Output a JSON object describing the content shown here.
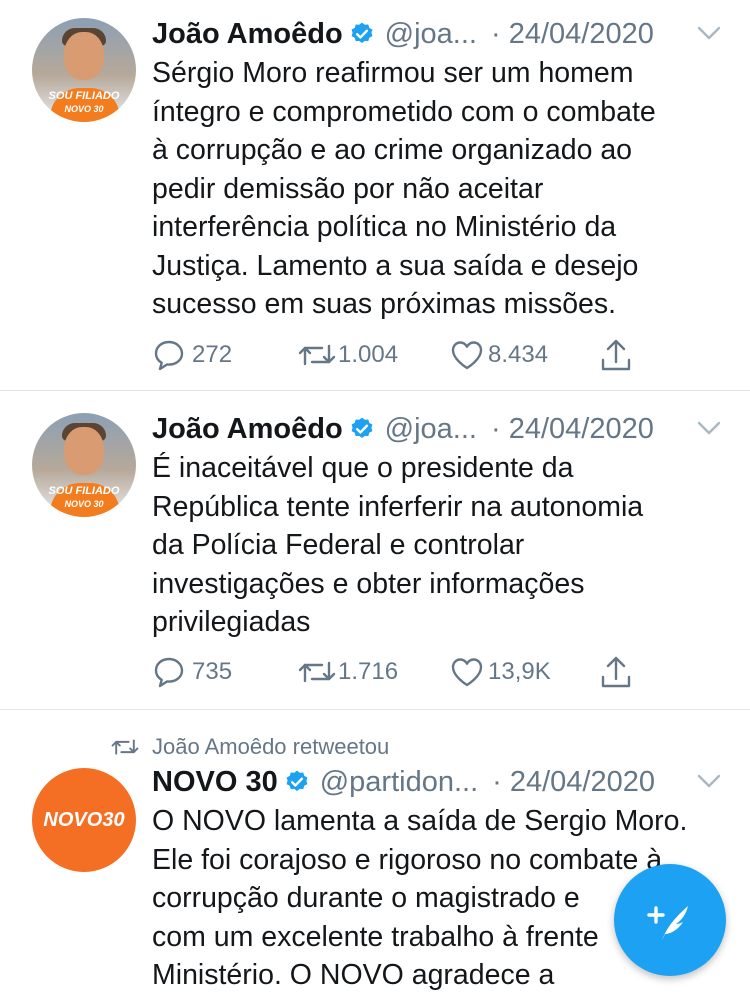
{
  "tweets": [
    {
      "author": "João Amoêdo",
      "handle": "@joa...",
      "date": "· 24/04/2020",
      "avatar": {
        "badge_top": "SOU FILIADO",
        "badge_bottom": "NOVO 30"
      },
      "text": "Sérgio Moro reafirmou ser um homem\níntegro e comprometido com o combate\nà corrupção e ao crime organizado ao\npedir demissão por não aceitar\ninterferência política no Ministério da\nJustiça. Lamento a sua saída e desejo\nsucesso em suas próximas missões.",
      "replies": "272",
      "retweets": "1.004",
      "likes": "8.434"
    },
    {
      "author": "João Amoêdo",
      "handle": "@joa...",
      "date": "· 24/04/2020",
      "avatar": {
        "badge_top": "SOU FILIADO",
        "badge_bottom": "NOVO 30"
      },
      "text": "É inaceitável que o presidente da\nRepública tente inferferir na autonomia\nda Polícia Federal e controlar\ninvestigações e obter informações\nprivilegiadas",
      "replies": "735",
      "retweets": "1.716",
      "likes": "13,9K"
    },
    {
      "retweeted_by": "João Amoêdo retweetou",
      "author": "NOVO 30",
      "handle": "@partidon...",
      "date": "· 24/04/2020",
      "avatar": {
        "logo": "NOVO30"
      },
      "text": "O NOVO lamenta a saída de Sergio Moro.\nEle foi corajoso e rigoroso no combate à\ncorrupção durante o magistrado e\ncom um excelente trabalho à frente\nMinistério. O NOVO agradece a"
    }
  ],
  "colors": {
    "accent": "#1da1f2",
    "muted": "#657786",
    "text": "#14171a",
    "brand_orange": "#f46f24"
  },
  "icons": [
    "verified-badge-icon",
    "chevron-down-icon",
    "reply-icon",
    "retweet-icon",
    "like-icon",
    "share-icon",
    "compose-tweet-icon"
  ]
}
